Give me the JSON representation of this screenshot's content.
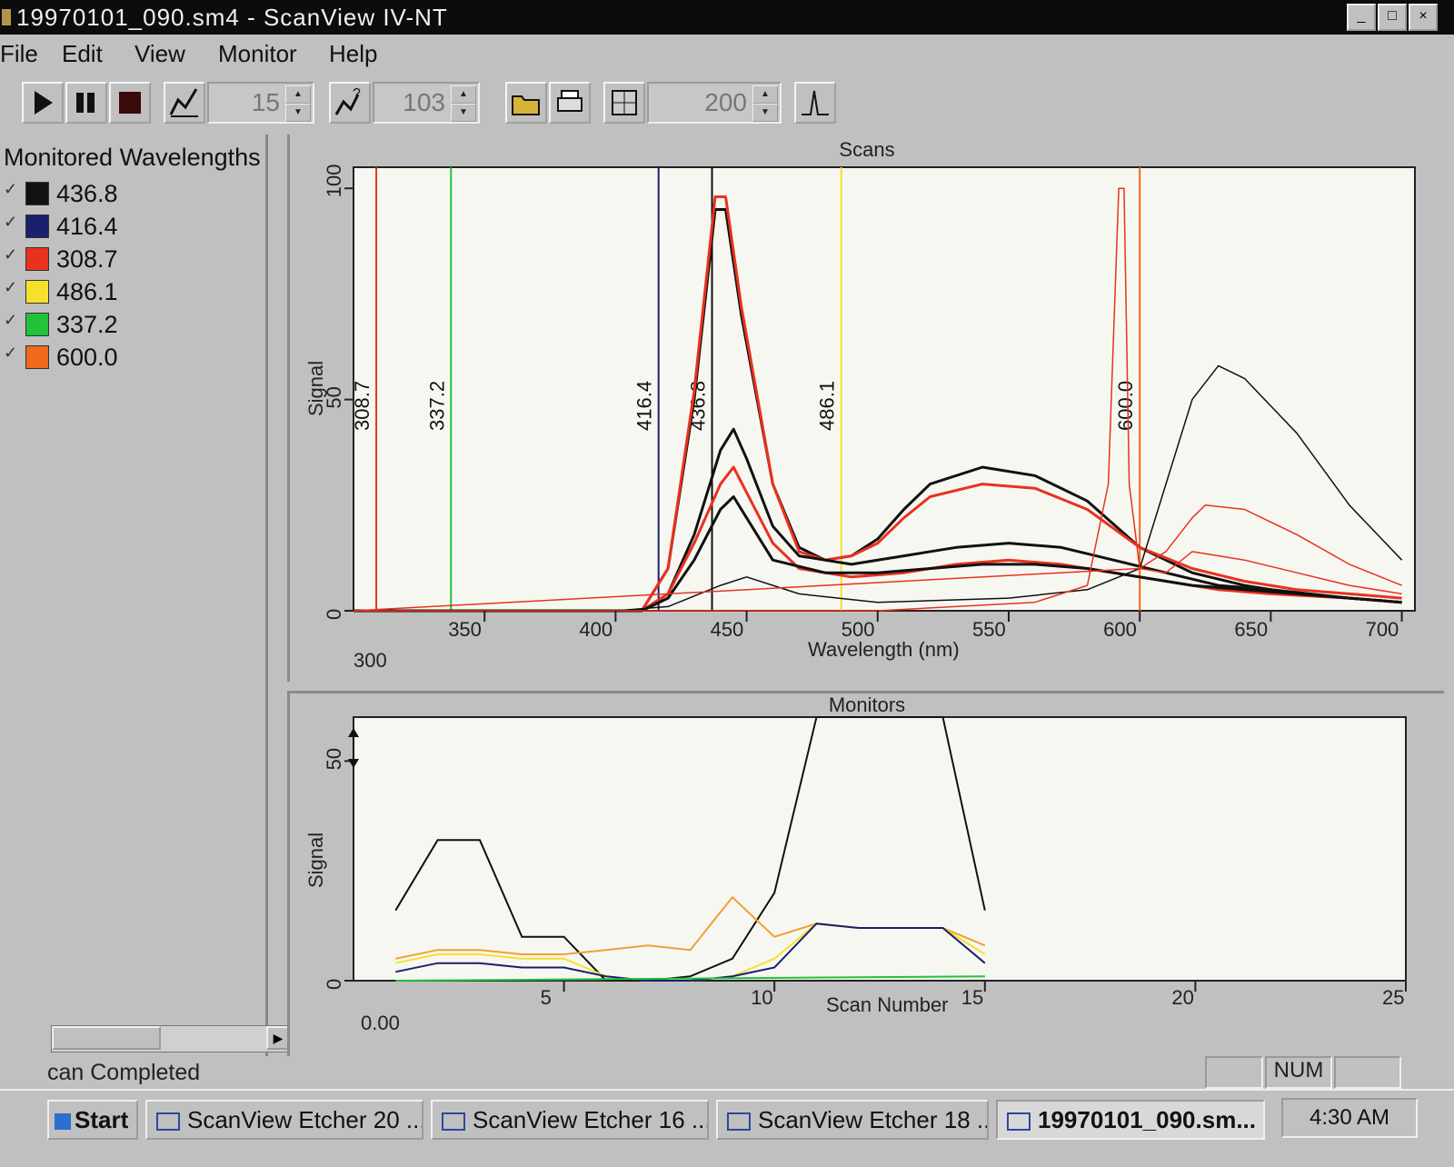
{
  "window": {
    "title": "19970101_090.sm4 - ScanView IV-NT",
    "controls": [
      "_",
      "□",
      "×"
    ]
  },
  "menu": [
    "File",
    "Edit",
    "View",
    "Monitor",
    "Help"
  ],
  "toolbar": {
    "play_icon": "play-icon",
    "pause_icon": "pause-icon",
    "stop_icon": "stop-icon",
    "spin1_value": "15",
    "spin2_value": "103",
    "spin3_value": "200"
  },
  "left_panel": {
    "title": "Monitored Wavelengths",
    "items": [
      {
        "label": "436.8",
        "color": "#111111"
      },
      {
        "label": "416.4",
        "color": "#1a1f6e"
      },
      {
        "label": "308.7",
        "color": "#e8321e"
      },
      {
        "label": "486.1",
        "color": "#f5e12c"
      },
      {
        "label": "337.2",
        "color": "#22c23a"
      },
      {
        "label": "600.0",
        "color": "#ef6a1c"
      }
    ]
  },
  "scans": {
    "title": "Scans",
    "xlabel": "Wavelength (nm)",
    "ylabel": "Signal",
    "x_start_label": "300",
    "x_ticks": [
      "350",
      "400",
      "450",
      "500",
      "550",
      "600",
      "650",
      "700"
    ],
    "y_ticks": [
      "0",
      "50",
      "100"
    ],
    "markers": [
      "308.7",
      "337.2",
      "416.4",
      "436.8",
      "486.1",
      "600.0"
    ]
  },
  "monitors": {
    "title": "Monitors",
    "xlabel": "Scan Number",
    "ylabel": "Signal",
    "x_start_label": "0.00",
    "x_ticks": [
      "5",
      "10",
      "15",
      "20",
      "25"
    ],
    "y_ticks": [
      "0",
      "50"
    ]
  },
  "status": {
    "text": "can Completed",
    "num": "NUM"
  },
  "taskbar": {
    "start": "Start",
    "tasks": [
      "ScanView Etcher 20 ...",
      "ScanView Etcher 16 ...",
      "ScanView Etcher 18 ...",
      "19970101_090.sm..."
    ],
    "clock": "4:30 AM"
  },
  "chart_data": [
    {
      "type": "line",
      "title": "Scans",
      "xlabel": "Wavelength (nm)",
      "ylabel": "Signal",
      "xlim": [
        300,
        705
      ],
      "ylim": [
        0,
        105
      ],
      "markers": [
        {
          "x": 308.7,
          "color": "#e8321e"
        },
        {
          "x": 337.2,
          "color": "#22c23a"
        },
        {
          "x": 416.4,
          "color": "#1a1f6e"
        },
        {
          "x": 436.8,
          "color": "#111111"
        },
        {
          "x": 486.1,
          "color": "#f5e12c"
        },
        {
          "x": 600.0,
          "color": "#ef6a1c"
        }
      ],
      "series": [
        {
          "color": "#111111",
          "width": 3,
          "x": [
            300,
            410,
            420,
            430,
            438,
            442,
            448,
            460,
            470,
            480,
            490,
            500,
            510,
            520,
            540,
            560,
            580,
            600,
            620,
            640,
            660,
            680,
            700
          ],
          "y": [
            0,
            0,
            10,
            50,
            95,
            95,
            70,
            30,
            15,
            12,
            13,
            17,
            24,
            30,
            34,
            32,
            26,
            15,
            9,
            6,
            4,
            3,
            2
          ]
        },
        {
          "color": "#e8321e",
          "width": 3,
          "x": [
            300,
            410,
            420,
            430,
            438,
            442,
            448,
            460,
            470,
            480,
            490,
            500,
            510,
            520,
            540,
            560,
            580,
            600,
            620,
            640,
            660,
            680,
            700
          ],
          "y": [
            0,
            0,
            10,
            52,
            98,
            98,
            72,
            30,
            14,
            12,
            13,
            16,
            22,
            27,
            30,
            29,
            24,
            15,
            10,
            7,
            5,
            4,
            3
          ]
        },
        {
          "color": "#111111",
          "width": 3,
          "x": [
            300,
            410,
            420,
            430,
            440,
            445,
            450,
            460,
            470,
            490,
            510,
            530,
            550,
            570,
            590,
            610,
            630,
            650,
            680,
            700
          ],
          "y": [
            0,
            0,
            4,
            18,
            38,
            43,
            36,
            20,
            13,
            11,
            13,
            15,
            16,
            15,
            12,
            9,
            6,
            5,
            3,
            2
          ]
        },
        {
          "color": "#e8321e",
          "width": 3,
          "x": [
            300,
            410,
            420,
            430,
            440,
            445,
            450,
            460,
            470,
            490,
            510,
            530,
            550,
            570,
            590,
            610,
            630,
            650,
            680,
            700
          ],
          "y": [
            0,
            0,
            4,
            16,
            30,
            34,
            28,
            16,
            10,
            8,
            9,
            11,
            12,
            11,
            9,
            7,
            5,
            4,
            3,
            2
          ]
        },
        {
          "color": "#111111",
          "width": 3,
          "x": [
            300,
            410,
            420,
            430,
            440,
            445,
            450,
            460,
            480,
            500,
            520,
            540,
            560,
            580,
            600,
            620,
            640,
            660,
            680,
            700
          ],
          "y": [
            0,
            0,
            3,
            12,
            24,
            27,
            22,
            12,
            9,
            9,
            10,
            11,
            11,
            10,
            8,
            6,
            5,
            4,
            3,
            2
          ]
        },
        {
          "color": "#111111",
          "width": 1.5,
          "x": [
            300,
            400,
            420,
            440,
            450,
            470,
            500,
            550,
            580,
            600,
            610,
            620,
            630,
            640,
            660,
            680,
            700
          ],
          "y": [
            0,
            0,
            1,
            6,
            8,
            4,
            2,
            3,
            5,
            10,
            30,
            50,
            58,
            55,
            42,
            25,
            12
          ]
        },
        {
          "color": "#e8321e",
          "width": 1.5,
          "x": [
            300,
            500,
            560,
            580,
            588,
            592,
            594,
            596,
            600,
            610,
            620,
            625,
            640,
            660,
            680,
            700
          ],
          "y": [
            0,
            0,
            2,
            6,
            30,
            100,
            100,
            30,
            10,
            14,
            22,
            25,
            24,
            18,
            11,
            6
          ]
        },
        {
          "color": "#e8321e",
          "width": 1.5,
          "x": [
            300,
            600,
            610,
            620,
            640,
            660,
            680,
            700
          ],
          "y": [
            0,
            10,
            9,
            14,
            12,
            9,
            6,
            4
          ]
        }
      ]
    },
    {
      "type": "line",
      "title": "Monitors",
      "xlabel": "Scan Number",
      "ylabel": "Signal",
      "xlim": [
        0,
        25
      ],
      "ylim": [
        0,
        60
      ],
      "series": [
        {
          "color": "#111111",
          "x": [
            1,
            2,
            3,
            4,
            5,
            6,
            7,
            8,
            9,
            10,
            11,
            12,
            13,
            14,
            15
          ],
          "y": [
            16,
            32,
            32,
            10,
            10,
            0,
            0,
            1,
            5,
            20,
            60,
            60,
            60,
            60,
            16
          ]
        },
        {
          "color": "#f0a030",
          "x": [
            1,
            2,
            3,
            4,
            5,
            6,
            7,
            8,
            9,
            10,
            11,
            12,
            13,
            14,
            15
          ],
          "y": [
            5,
            7,
            7,
            6,
            6,
            7,
            8,
            7,
            19,
            10,
            13,
            12,
            12,
            12,
            8
          ]
        },
        {
          "color": "#f5e12c",
          "x": [
            1,
            2,
            3,
            4,
            5,
            6,
            7,
            8,
            9,
            10,
            11,
            12,
            13,
            14,
            15
          ],
          "y": [
            4,
            6,
            6,
            5,
            5,
            1,
            0,
            0,
            1,
            5,
            13,
            12,
            12,
            12,
            6
          ]
        },
        {
          "color": "#1a1f6e",
          "x": [
            1,
            2,
            3,
            4,
            5,
            6,
            7,
            8,
            9,
            10,
            11,
            12,
            13,
            14,
            15
          ],
          "y": [
            2,
            4,
            4,
            3,
            3,
            1,
            0,
            0,
            1,
            3,
            13,
            12,
            12,
            12,
            4
          ]
        },
        {
          "color": "#22c23a",
          "x": [
            1,
            15
          ],
          "y": [
            0,
            1
          ]
        }
      ]
    }
  ]
}
